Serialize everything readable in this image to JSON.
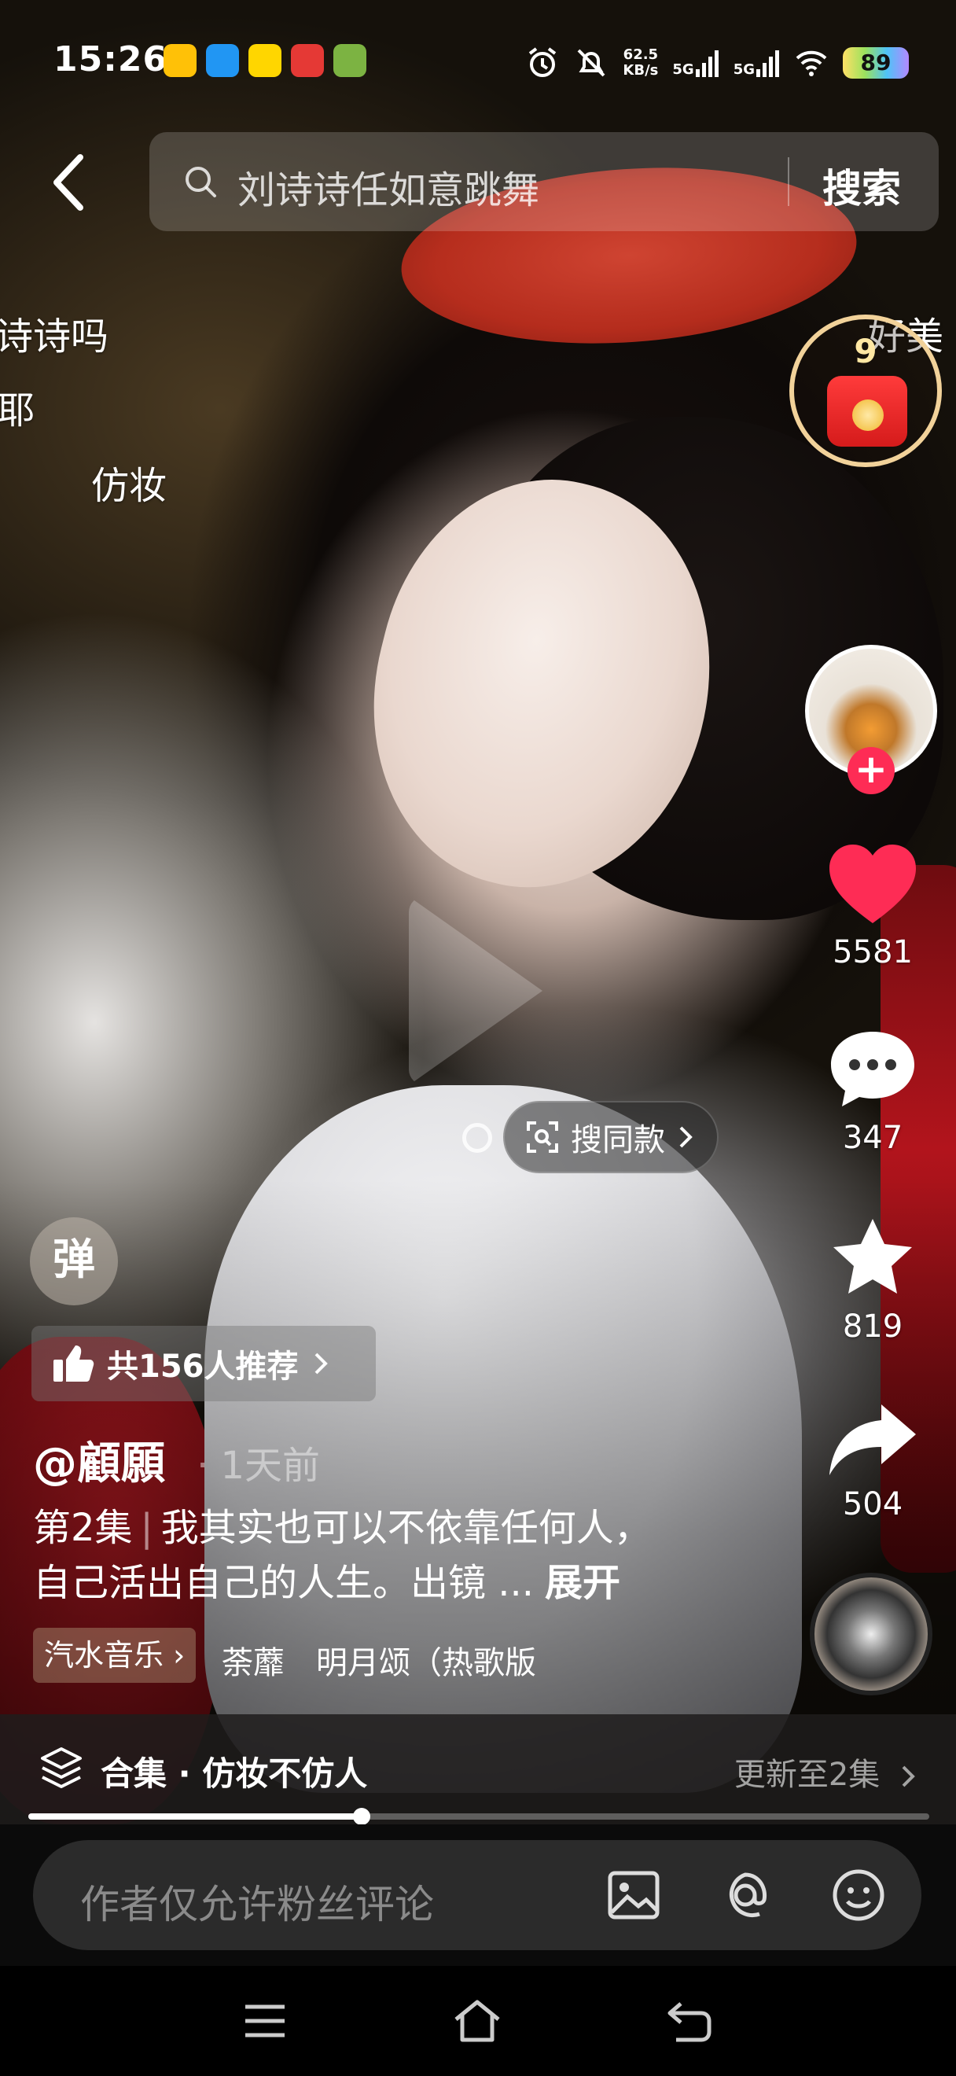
{
  "status_bar": {
    "time": "15:26",
    "network_speed_value": "62.5",
    "network_speed_unit": "KB/s",
    "signal1": "5G",
    "signal2": "5G",
    "battery": "89"
  },
  "search": {
    "query": "刘诗诗任如意跳舞",
    "button_label": "搜索"
  },
  "danmaku": [
    "诗诗吗",
    "耶",
    "仿妆",
    "好美"
  ],
  "red_packet": {
    "count": "9"
  },
  "actions": {
    "likes": "5581",
    "comments": "347",
    "favorites": "819",
    "shares": "504"
  },
  "search_same": {
    "label": "搜同款"
  },
  "danmu_toggle": {
    "label": "弹"
  },
  "recommend": {
    "label": "共156人推荐"
  },
  "post": {
    "author": "@顧願",
    "time_ago": "· 1天前",
    "episode": "第2集",
    "desc_line1": "我其实也可以不依靠任何人，",
    "desc_line2": "自己活出自己的人生。出镜 ...",
    "expand": "展开"
  },
  "music": {
    "tag": "汽水音乐 ›",
    "name": "荼蘼　明月颂（热歌版"
  },
  "collection": {
    "title": "合集 · 仿妆不仿人",
    "update": "更新至2集"
  },
  "progress": {
    "value": 0.37
  },
  "comment": {
    "placeholder": "作者仅允许粉丝评论"
  },
  "colors": {
    "like": "#fe2c55",
    "follow": "#fe2c55",
    "red_packet_ring": "#f2d29a"
  }
}
